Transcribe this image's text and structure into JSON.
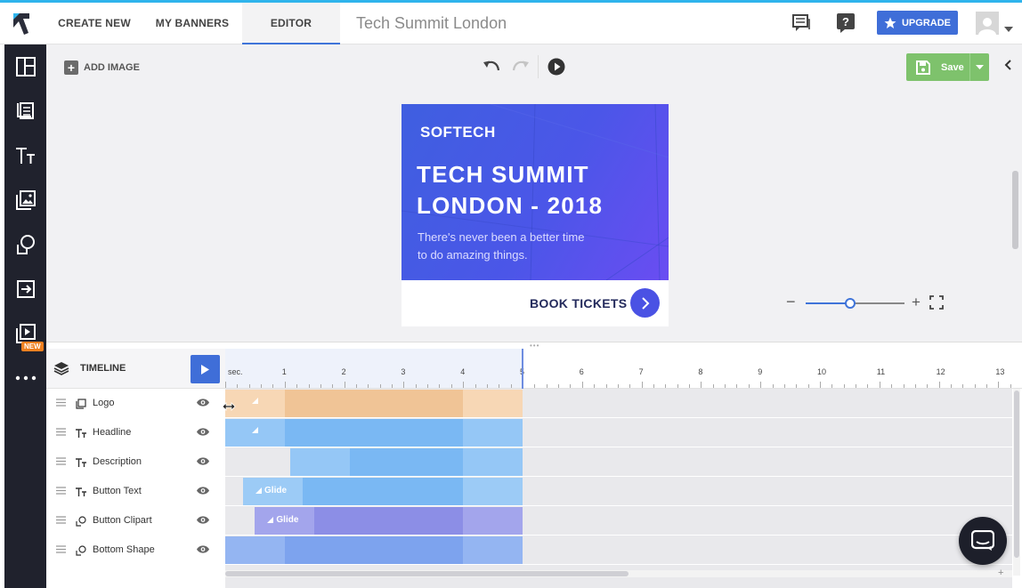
{
  "nav": {
    "create_new": "CREATE NEW",
    "my_banners": "MY BANNERS",
    "editor": "EDITOR",
    "document_title": "Tech Summit London",
    "upgrade": "UPGRADE"
  },
  "sidebar": {
    "new_badge": "NEW",
    "icons": [
      "layout-icon",
      "text-list-icon",
      "text-icon",
      "image-icon",
      "shapes-icon",
      "import-icon",
      "video-icon",
      "more-icon"
    ]
  },
  "toolbar": {
    "add_image": "ADD IMAGE",
    "save": "Save"
  },
  "banner": {
    "logo": "SOFTECH",
    "headline_line1": "TECH SUMMIT",
    "headline_line2": "LONDON - 2018",
    "desc_line1": "There's never been a better time",
    "desc_line2": "to do amazing things.",
    "cta": "BOOK TICKETS"
  },
  "zoom": {
    "level_fraction": 0.45
  },
  "timeline": {
    "title": "TIMELINE",
    "ruler_unit": "sec.",
    "ruler_labels": [
      "1",
      "2",
      "3",
      "4",
      "5",
      "6",
      "7",
      "8",
      "9",
      "10",
      "11",
      "12",
      "13"
    ],
    "layers": [
      {
        "name": "Logo",
        "type": "image-layer-icon"
      },
      {
        "name": "Headline",
        "type": "text-layer-icon"
      },
      {
        "name": "Description",
        "type": "text-layer-icon"
      },
      {
        "name": "Button Text",
        "type": "text-layer-icon"
      },
      {
        "name": "Button Clipart",
        "type": "shape-layer-icon"
      },
      {
        "name": "Bottom Shape",
        "type": "shape-layer-icon"
      }
    ],
    "bars": [
      {
        "label": "",
        "start": 0.0,
        "entry_end": 1.0,
        "exit_start": 4.0,
        "end": 5.0,
        "color": "#f0c496",
        "edge": "#f7d7b5",
        "glide_icon": true
      },
      {
        "label": "",
        "start": 0.0,
        "entry_end": 1.0,
        "exit_start": 4.0,
        "end": 5.0,
        "color": "#7ab8f3",
        "edge": "#95c7f6",
        "glide_icon": true
      },
      {
        "label": "",
        "start": 1.1,
        "entry_end": 2.1,
        "exit_start": 4.0,
        "end": 5.0,
        "color": "#7ab8f3",
        "edge": "#95c7f6",
        "glide_icon": false
      },
      {
        "label": "Glide",
        "start": 0.3,
        "entry_end": 1.3,
        "exit_start": 4.0,
        "end": 5.0,
        "color": "#7ab8f3",
        "edge": "#9ccbf6",
        "glide_icon": true
      },
      {
        "label": "Glide",
        "start": 0.5,
        "entry_end": 1.5,
        "exit_start": 4.0,
        "end": 5.0,
        "color": "#8c8ee6",
        "edge": "#a3a5ec",
        "glide_icon": true
      },
      {
        "label": "",
        "start": 0.0,
        "entry_end": 1.0,
        "exit_start": 4.0,
        "end": 5.0,
        "color": "#7da3ee",
        "edge": "#94b5f2",
        "glide_icon": false
      }
    ]
  }
}
